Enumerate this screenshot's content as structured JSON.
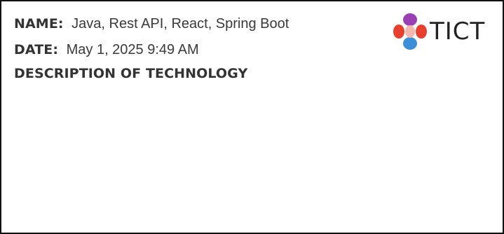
{
  "name": {
    "label": "NAME:",
    "value": "Java, Rest API, React, Spring Boot"
  },
  "date": {
    "label": "DATE:",
    "value": "May 1, 2025 9:49 AM"
  },
  "description": {
    "heading": "DESCRIPTION OF TECHNOLOGY",
    "body": ""
  },
  "logo": {
    "text": "TICT",
    "colors": {
      "top": "#9b3fb5",
      "left": "#e8402f",
      "right": "#e8402f",
      "bottom": "#3b8fd9",
      "center_light": "#f4b8b0"
    }
  }
}
